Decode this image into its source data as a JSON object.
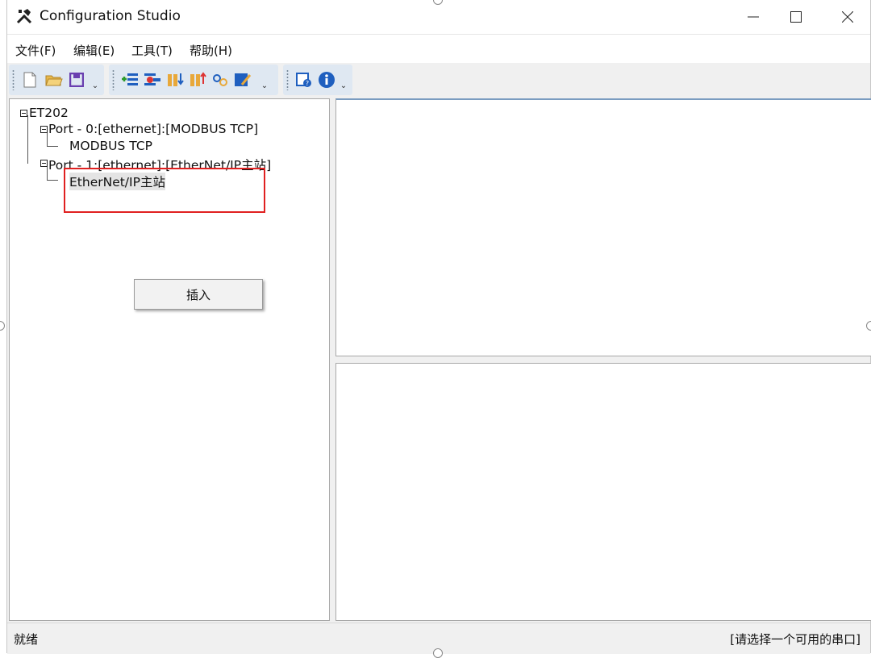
{
  "window": {
    "title": "Configuration Studio",
    "minimize_icon": "minimize-icon",
    "maximize_icon": "maximize-icon",
    "close_icon": "close-icon"
  },
  "menubar": {
    "items": [
      "文件(F)",
      "编辑(E)",
      "工具(T)",
      "帮助(H)"
    ]
  },
  "toolbar": {
    "group1": [
      "new-file-icon",
      "open-folder-icon",
      "save-icon"
    ],
    "group2": [
      "add-list-icon",
      "remove-list-icon",
      "import-icon",
      "export-icon",
      "link-icon",
      "edit-icon"
    ],
    "group3": [
      "help-topics-icon",
      "info-icon"
    ]
  },
  "tree": {
    "root": "ET202",
    "port0": "Port - 0:[ethernet]:[MODBUS TCP]",
    "port0_child": "MODBUS TCP",
    "port1": "Port - 1:[ethernet]:[EtherNet/IP主站]",
    "port1_child": "EtherNet/IP主站"
  },
  "context_menu": {
    "items": [
      "插入"
    ]
  },
  "statusbar": {
    "left": "就绪",
    "right": "[请选择一个可用的串口]"
  },
  "colors": {
    "highlight_box": "#e02020",
    "toolbar_blue": "#1f5fbf"
  }
}
